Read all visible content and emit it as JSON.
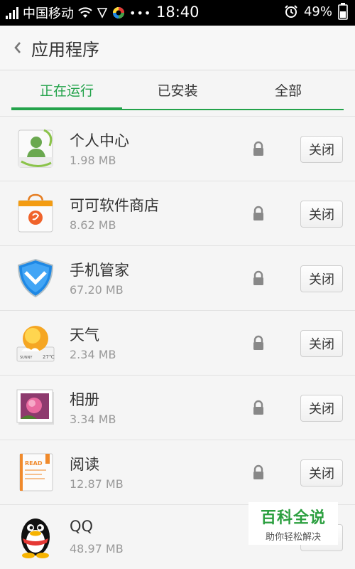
{
  "status_bar": {
    "carrier": "中国移动",
    "time": "18:40",
    "battery": "49%"
  },
  "header": {
    "title": "应用程序"
  },
  "tabs": [
    {
      "label": "正在运行",
      "active": true
    },
    {
      "label": "已安装",
      "active": false
    },
    {
      "label": "全部",
      "active": false
    }
  ],
  "apps": [
    {
      "name": "个人中心",
      "size": "1.98 MB",
      "icon": "person-center-icon",
      "button": "关闭"
    },
    {
      "name": "可可软件商店",
      "size": "8.62 MB",
      "icon": "app-store-icon",
      "button": "关闭"
    },
    {
      "name": "手机管家",
      "size": "67.20 MB",
      "icon": "phone-manager-icon",
      "button": "关闭"
    },
    {
      "name": "天气",
      "size": "2.34 MB",
      "icon": "weather-icon",
      "button": "关闭",
      "icon_text": "SUNNY 27℃"
    },
    {
      "name": "相册",
      "size": "3.34 MB",
      "icon": "gallery-icon",
      "button": "关闭"
    },
    {
      "name": "阅读",
      "size": "12.87 MB",
      "icon": "reader-icon",
      "button": "关闭",
      "icon_text": "READ"
    },
    {
      "name": "QQ",
      "size": "48.97 MB",
      "icon": "qq-penguin-icon",
      "button": "关闭"
    }
  ],
  "watermark": {
    "title": "百科全说",
    "subtitle": "助你轻松解决"
  },
  "colors": {
    "accent": "#24a34b",
    "status_bar_bg": "#000000"
  }
}
